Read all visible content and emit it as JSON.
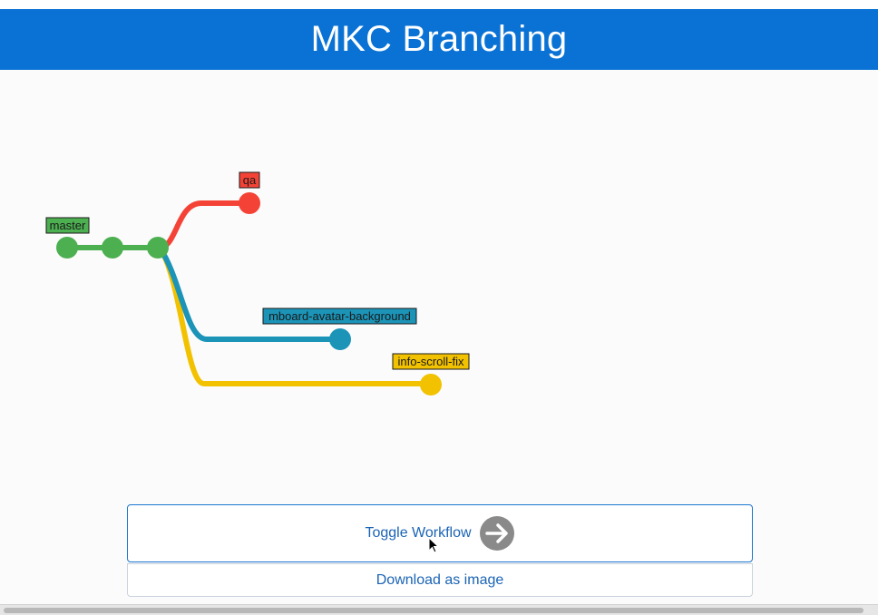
{
  "header": {
    "title": "MKC Branching",
    "background_color": "#0a72d4"
  },
  "graph": {
    "branches": [
      {
        "name": "master",
        "color": "#4caf50",
        "commits": 3
      },
      {
        "name": "qa",
        "color": "#f44336",
        "commits": 1
      },
      {
        "name": "mboard-avatar-background",
        "color": "#1b94b8",
        "commits": 1
      },
      {
        "name": "info-scroll-fix",
        "color": "#f2c200",
        "commits": 1
      }
    ]
  },
  "actions": {
    "toggle_label": "Toggle Workflow",
    "toggle_icon": "arrow-right-circle-icon",
    "download_label": "Download as image"
  }
}
